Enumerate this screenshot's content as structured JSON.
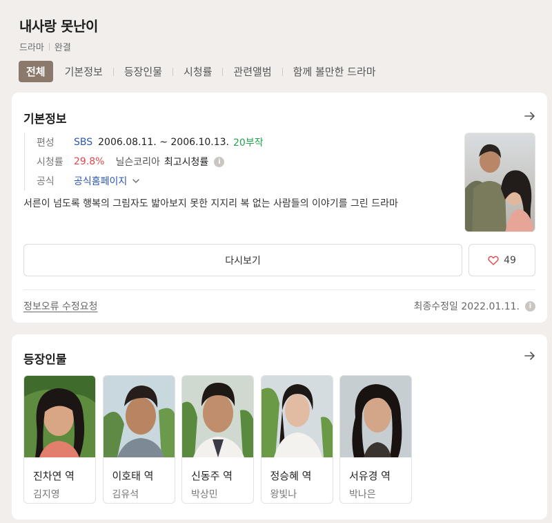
{
  "header": {
    "title": "내사랑 못난이",
    "genre": "드라마",
    "status": "완결",
    "tabs": [
      "전체",
      "기본정보",
      "등장인물",
      "시청률",
      "관련앨범",
      "함께 볼만한 드라마"
    ]
  },
  "basic_info": {
    "section_title": "기본정보",
    "rows": {
      "broadcast_label": "편성",
      "channel": "SBS",
      "period": "2006.08.11. ~ 2006.10.13.",
      "episodes": "20부작",
      "rating_label": "시청률",
      "rating_value": "29.8%",
      "rating_source": "닐슨코리아",
      "rating_note": "최고시청률",
      "official_label": "공식",
      "official_link": "공식홈페이지"
    },
    "description": "서른이 넘도록 행복의 그림자도 밟아보지 못한 지지리 복 없는 사람들의 이야기를 그린 드라마",
    "rewatch_button": "다시보기",
    "like_count": "49",
    "report_link": "정보오류 수정요청",
    "last_updated": "최종수정일 2022.01.11."
  },
  "cast_section": {
    "section_title": "등장인물",
    "members": [
      {
        "role": "진차연 역",
        "actor": "김지영"
      },
      {
        "role": "이호태 역",
        "actor": "김유석"
      },
      {
        "role": "신동주 역",
        "actor": "박상민"
      },
      {
        "role": "정승혜 역",
        "actor": "왕빛나"
      },
      {
        "role": "서유경 역",
        "actor": "박나은"
      }
    ]
  },
  "colors": {
    "page_bg": "#f1eeeb",
    "active_tab": "#8b7a6c",
    "link_blue": "#2a56b8",
    "episodes_green": "#26a24d",
    "rating_red": "#e0484b"
  },
  "icons": [
    "arrow-right-icon",
    "info-icon",
    "chevron-down-icon",
    "heart-icon"
  ]
}
